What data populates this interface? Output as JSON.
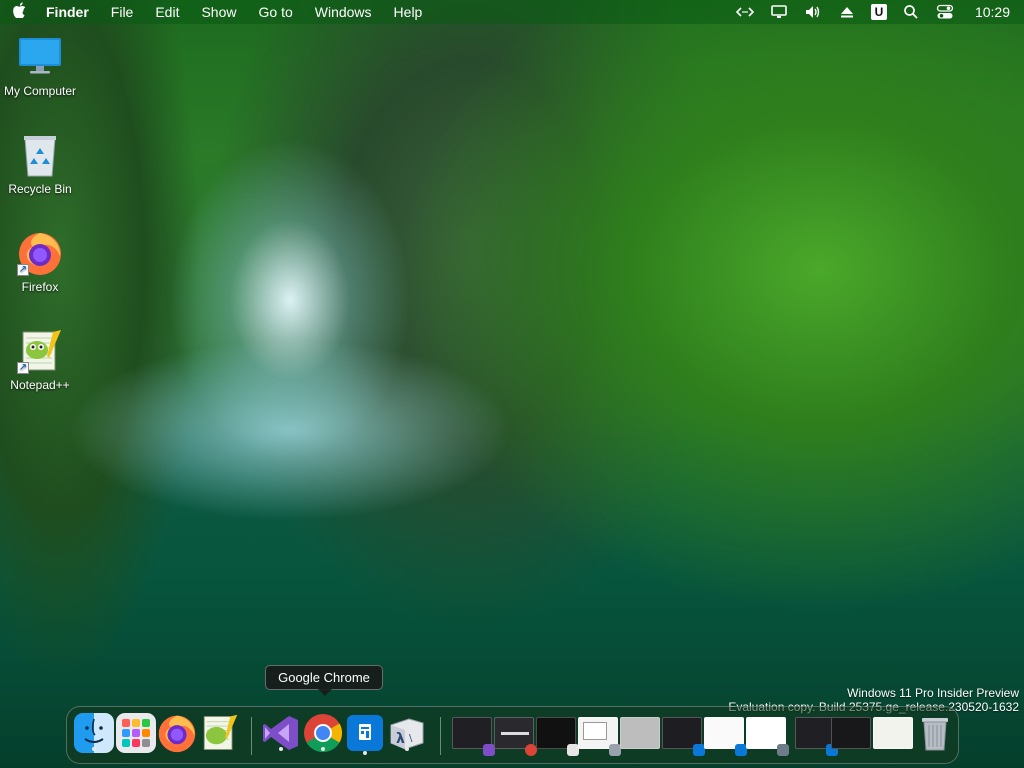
{
  "menubar": {
    "apple_icon": "apple-icon",
    "app_name": "Finder",
    "menus": [
      "File",
      "Edit",
      "Show",
      "Go to",
      "Windows",
      "Help"
    ],
    "tray_u_label": "U",
    "clock": "10:29"
  },
  "desktop_icons": [
    {
      "label": "My Computer",
      "icon": "monitor-icon"
    },
    {
      "label": "Recycle Bin",
      "icon": "recycle-bin-icon"
    },
    {
      "label": "Firefox",
      "icon": "firefox-icon"
    },
    {
      "label": "Notepad++",
      "icon": "notepadpp-icon"
    }
  ],
  "watermark": {
    "line1": "Windows 11 Pro Insider Preview",
    "line2": "Evaluation copy. Build 25375.ge_release.230520-1632"
  },
  "tooltip": {
    "text": "Google Chrome"
  },
  "dock": {
    "apps": [
      {
        "name": "Finder",
        "icon": "finder-icon",
        "running": true
      },
      {
        "name": "Launchpad",
        "icon": "launchpad-icon",
        "running": false
      },
      {
        "name": "Firefox",
        "icon": "firefox-icon",
        "running": false
      },
      {
        "name": "Notepad++",
        "icon": "notepadpp-icon",
        "running": false
      },
      {
        "name": "Visual Studio",
        "icon": "visual-studio-icon",
        "running": true
      },
      {
        "name": "Google Chrome",
        "icon": "chrome-icon",
        "running": true
      },
      {
        "name": "Winaero Tweaker",
        "icon": "blue-app-icon",
        "running": true
      },
      {
        "name": "Lambda App",
        "icon": "lambda-icon",
        "running": true
      }
    ],
    "trash_icon": "trash-icon"
  },
  "colors": {
    "menubar_bg": "#0a5a14",
    "dock_bg": "#14371e",
    "chrome_red": "#db4437",
    "chrome_green": "#0f9d58",
    "chrome_yellow": "#f4b400",
    "chrome_blue": "#4285f4"
  }
}
